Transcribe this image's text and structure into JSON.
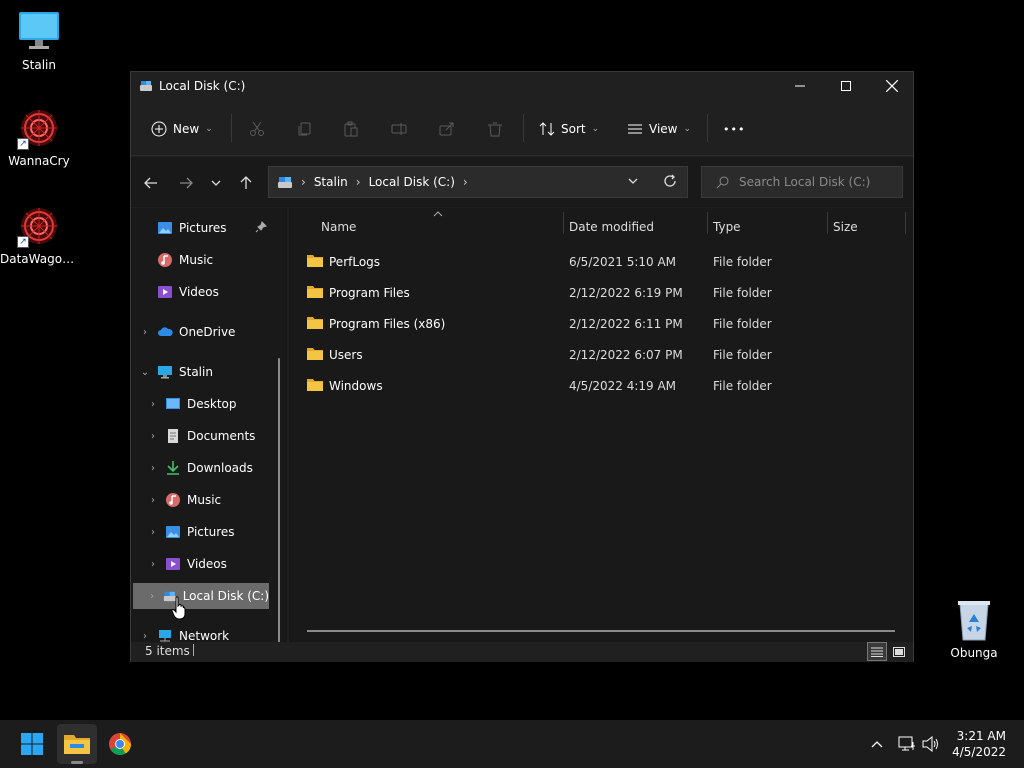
{
  "desktop": {
    "icons": [
      {
        "label": "Stalin"
      },
      {
        "label": "WannaCry"
      },
      {
        "label": "DataWagon..."
      },
      {
        "label": "Obunga"
      }
    ]
  },
  "window": {
    "title": "Local Disk (C:)",
    "controls": {
      "minimize": "—",
      "maximize": "☐",
      "close": "✕"
    }
  },
  "commandbar": {
    "new_label": "New",
    "sort_label": "Sort",
    "view_label": "View",
    "more_label": "•••"
  },
  "address": {
    "segments": [
      "Stalin",
      "Local Disk (C:)"
    ],
    "search_placeholder": "Search Local Disk (C:)"
  },
  "navpane": {
    "items": [
      {
        "label": "Pictures"
      },
      {
        "label": "Music"
      },
      {
        "label": "Videos"
      },
      {
        "label": "OneDrive"
      },
      {
        "label": "Stalin"
      },
      {
        "label": "Desktop"
      },
      {
        "label": "Documents"
      },
      {
        "label": "Downloads"
      },
      {
        "label": "Music"
      },
      {
        "label": "Pictures"
      },
      {
        "label": "Videos"
      },
      {
        "label": "Local Disk (C:)"
      },
      {
        "label": "Network"
      }
    ]
  },
  "columns": {
    "name": "Name",
    "date": "Date modified",
    "type": "Type",
    "size": "Size"
  },
  "files": [
    {
      "name": "PerfLogs",
      "date": "6/5/2021 5:10 AM",
      "type": "File folder"
    },
    {
      "name": "Program Files",
      "date": "2/12/2022 6:19 PM",
      "type": "File folder"
    },
    {
      "name": "Program Files (x86)",
      "date": "2/12/2022 6:11 PM",
      "type": "File folder"
    },
    {
      "name": "Users",
      "date": "2/12/2022 6:07 PM",
      "type": "File folder"
    },
    {
      "name": "Windows",
      "date": "4/5/2022 4:19 AM",
      "type": "File folder"
    }
  ],
  "status": {
    "items": "5 items"
  },
  "taskbar": {
    "time": "3:21 AM",
    "date": "4/5/2022"
  },
  "colors": {
    "accent": "#0078d4",
    "folder": "#f4c542",
    "window_bg": "#191919",
    "selected": "#6b6b6b"
  }
}
